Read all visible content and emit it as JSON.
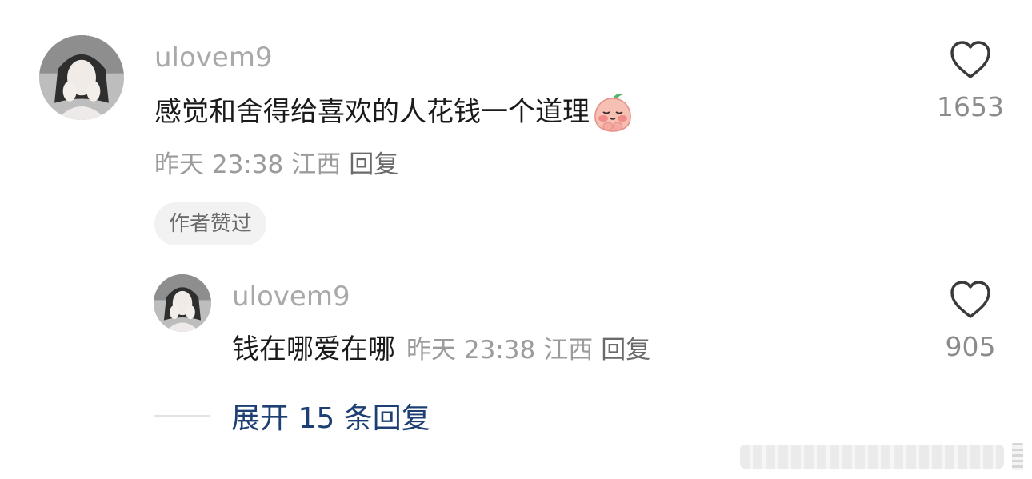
{
  "comment": {
    "username": "ulovem9",
    "text": "感觉和舍得给喜欢的人花钱一个道理",
    "emoji": "shy-peach-sticker",
    "time": "昨天 23:38",
    "location": "江西",
    "reply_label": "回复",
    "author_liked_badge": "作者赞过",
    "like_count": "1653"
  },
  "reply": {
    "username": "ulovem9",
    "text": "钱在哪爱在哪",
    "time": "昨天 23:38",
    "location": "江西",
    "reply_label": "回复",
    "like_count": "905"
  },
  "expand": {
    "label": "展开 15 条回复"
  },
  "icons": {
    "like": "heart-outline-icon",
    "avatar": "user-avatar-photo"
  },
  "colors": {
    "link": "#1d3f73",
    "muted": "#9b9b9b",
    "text": "#1a1a1a",
    "badge_bg": "#f2f2f2"
  }
}
